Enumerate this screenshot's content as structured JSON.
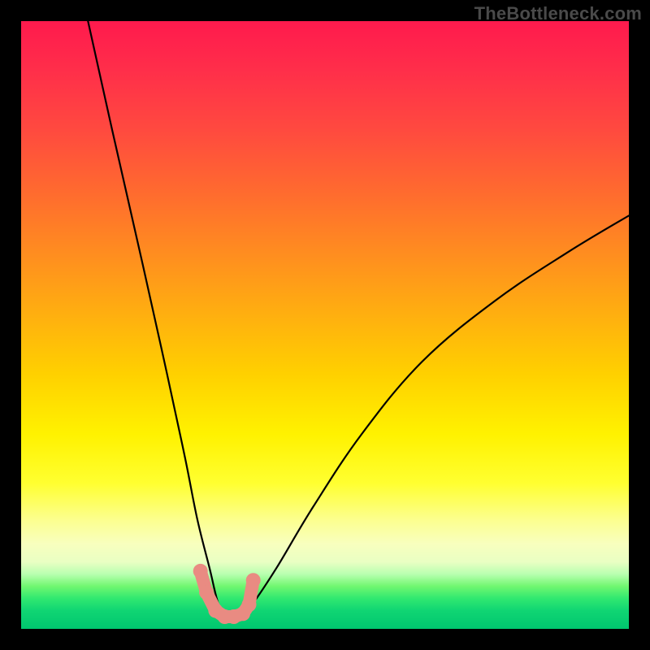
{
  "watermark": "TheBottleneck.com",
  "chart_data": {
    "type": "line",
    "title": "",
    "xlabel": "",
    "ylabel": "",
    "ylim": [
      0,
      100
    ],
    "xlim": [
      0,
      100
    ],
    "series": [
      {
        "name": "bottleneck-curve",
        "x": [
          11,
          15,
          20,
          24,
          27,
          29,
          31,
          32.5,
          34,
          36,
          38,
          42,
          48,
          56,
          66,
          78,
          90,
          100
        ],
        "values": [
          100,
          82,
          60,
          42,
          28,
          18,
          10,
          4,
          2,
          2,
          4,
          10,
          20,
          32,
          44,
          54,
          62,
          68
        ]
      }
    ],
    "markers": {
      "name": "highlight-dots",
      "x": [
        29.5,
        30.5,
        32,
        33.5,
        35,
        36.5,
        37.5,
        38.2
      ],
      "values": [
        9.5,
        6,
        3,
        2,
        2,
        2.5,
        4,
        8
      ]
    },
    "gradient_stops": [
      {
        "pos": 0,
        "color": "#ff1a4d"
      },
      {
        "pos": 50,
        "color": "#ffd000"
      },
      {
        "pos": 80,
        "color": "#ffff60"
      },
      {
        "pos": 100,
        "color": "#00c66f"
      }
    ]
  }
}
